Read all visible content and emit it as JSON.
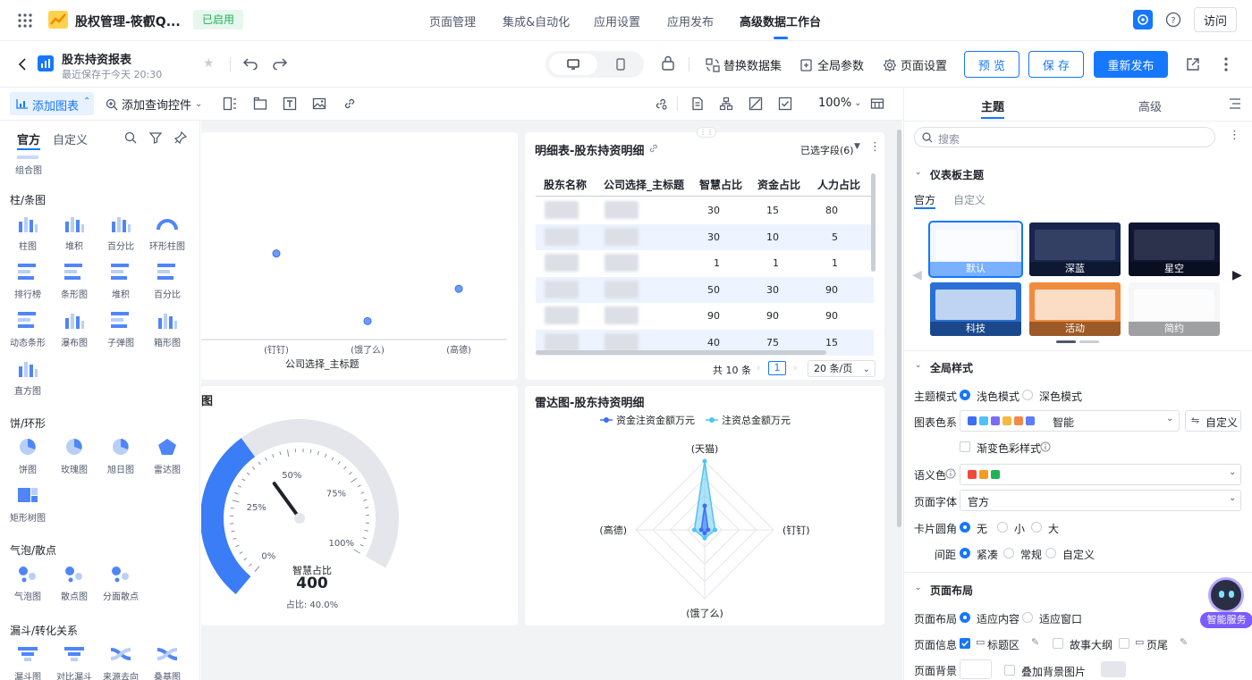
{
  "header": {
    "app_title": "股权管理-筱叡Q...",
    "status_badge": "已启用",
    "nav_tabs": [
      "页面管理",
      "集成&自动化",
      "应用设置",
      "应用发布",
      "高级数据工作台"
    ],
    "visit_label": "访问"
  },
  "report": {
    "title": "股东持资报表",
    "saved_time": "最近保存于今天 20:30"
  },
  "toolbar": {
    "replace_dataset": "替换数据集",
    "global_params": "全局参数",
    "page_settings": "页面设置",
    "preview": "预 览",
    "save": "保 存",
    "republish": "重新发布"
  },
  "edit_toolbar": {
    "add_chart": "添加图表",
    "add_query": "添加查询控件",
    "zoom": "100%"
  },
  "left_panel": {
    "tabs": [
      "官方",
      "自定义"
    ],
    "combo_label": "组合图",
    "categories": [
      {
        "title": "柱/条图",
        "items": [
          "柱图",
          "堆积",
          "百分比",
          "环形柱图",
          "排行榜",
          "条形图",
          "堆积",
          "百分比",
          "动态条形",
          "瀑布图",
          "子弹图",
          "箱形图",
          "直方图"
        ]
      },
      {
        "title": "饼/环形",
        "items": [
          "饼图",
          "玫瑰图",
          "旭日图",
          "雷达图",
          "矩形树图"
        ]
      },
      {
        "title": "气泡/散点",
        "items": [
          "气泡图",
          "散点图",
          "分面散点"
        ]
      },
      {
        "title": "漏斗/转化关系",
        "items": [
          "漏斗图",
          "对比漏斗",
          "来源去向",
          "桑基图"
        ]
      }
    ]
  },
  "scatter_card": {
    "x_ticks": [
      "(钉钉)",
      "(饿了么)",
      "(高德)"
    ],
    "x_label": "公司选择_主标题",
    "points": [
      {
        "category": "(钉钉)",
        "level": 0.56
      },
      {
        "category": "(饿了么)",
        "level": 0.12
      },
      {
        "category": "(高德)",
        "level": 0.33
      }
    ]
  },
  "table_card": {
    "title": "明细表-股东持资明细",
    "field_selector": "已选字段(6)",
    "columns": [
      "股东名称",
      "公司选择_主标题",
      "智慧占比",
      "资金占比",
      "人力占比"
    ],
    "rows": [
      [
        "30",
        "15",
        "80"
      ],
      [
        "30",
        "10",
        "5"
      ],
      [
        "1",
        "1",
        "1"
      ],
      [
        "50",
        "30",
        "90"
      ],
      [
        "90",
        "90",
        "90"
      ],
      [
        "40",
        "75",
        "15"
      ]
    ],
    "total": "共 10 条",
    "page": "1",
    "page_size": "20 条/页"
  },
  "gauge_card": {
    "ticks": [
      "0%",
      "25%",
      "50%",
      "75%",
      "100%"
    ],
    "metric_label": "智慧占比",
    "value": "400",
    "ratio_text": "占比: 40.0%",
    "ratio": 0.4
  },
  "radar_card": {
    "title": "雷达图-股东持资明细",
    "legend": [
      "资金注资金额万元",
      "注资总金额万元"
    ],
    "axes": [
      "(天猫)",
      "(钉钉)",
      "(饿了么)",
      "(高德)"
    ],
    "series": [
      {
        "name": "资金注资金额万元",
        "values": [
          0.35,
          0.05,
          0.05,
          0.05
        ]
      },
      {
        "name": "注资总金额万元",
        "values": [
          1.0,
          0.15,
          0.12,
          0.15
        ]
      }
    ]
  },
  "right_panel": {
    "tabs": [
      "主题",
      "高级"
    ],
    "search_placeholder": "搜索",
    "dashboard_theme": "仪表板主题",
    "theme_tabs": [
      "官方",
      "自定义"
    ],
    "themes": [
      "默认",
      "深蓝",
      "星空",
      "科技",
      "活动",
      "简约"
    ],
    "global_style": "全局样式",
    "theme_mode_label": "主题模式",
    "theme_mode_options": [
      "浅色模式",
      "深色模式"
    ],
    "chart_palette_label": "图表色系",
    "palette_name": "智能",
    "custom_label": "自定义",
    "gradient_label": "渐变色彩样式",
    "semantic_color_label": "语义色",
    "page_font_label": "页面字体",
    "page_font_value": "官方",
    "card_radius_label": "卡片圆角",
    "card_radius_options": [
      "无",
      "小",
      "大"
    ],
    "spacing_label": "间距",
    "spacing_options": [
      "紧凑",
      "常规",
      "自定义"
    ],
    "page_layout": "页面布局",
    "layout_label": "页面布局",
    "layout_options": [
      "适应内容",
      "适应窗口"
    ],
    "page_info_label": "页面信息",
    "page_info_options": [
      "标题区",
      "故事大纲",
      "页尾"
    ],
    "page_bg_label": "页面背景",
    "bg_image_label": "叠加背景图片",
    "smart_service": "智能服务",
    "palette_colors": [
      "#3b6ff5",
      "#4fc3f7",
      "#7e6cf0",
      "#f5b941",
      "#f08a4b",
      "#5c7cfa"
    ],
    "semantic_colors": [
      "#f5483b",
      "#f59a23",
      "#1fb356"
    ]
  }
}
